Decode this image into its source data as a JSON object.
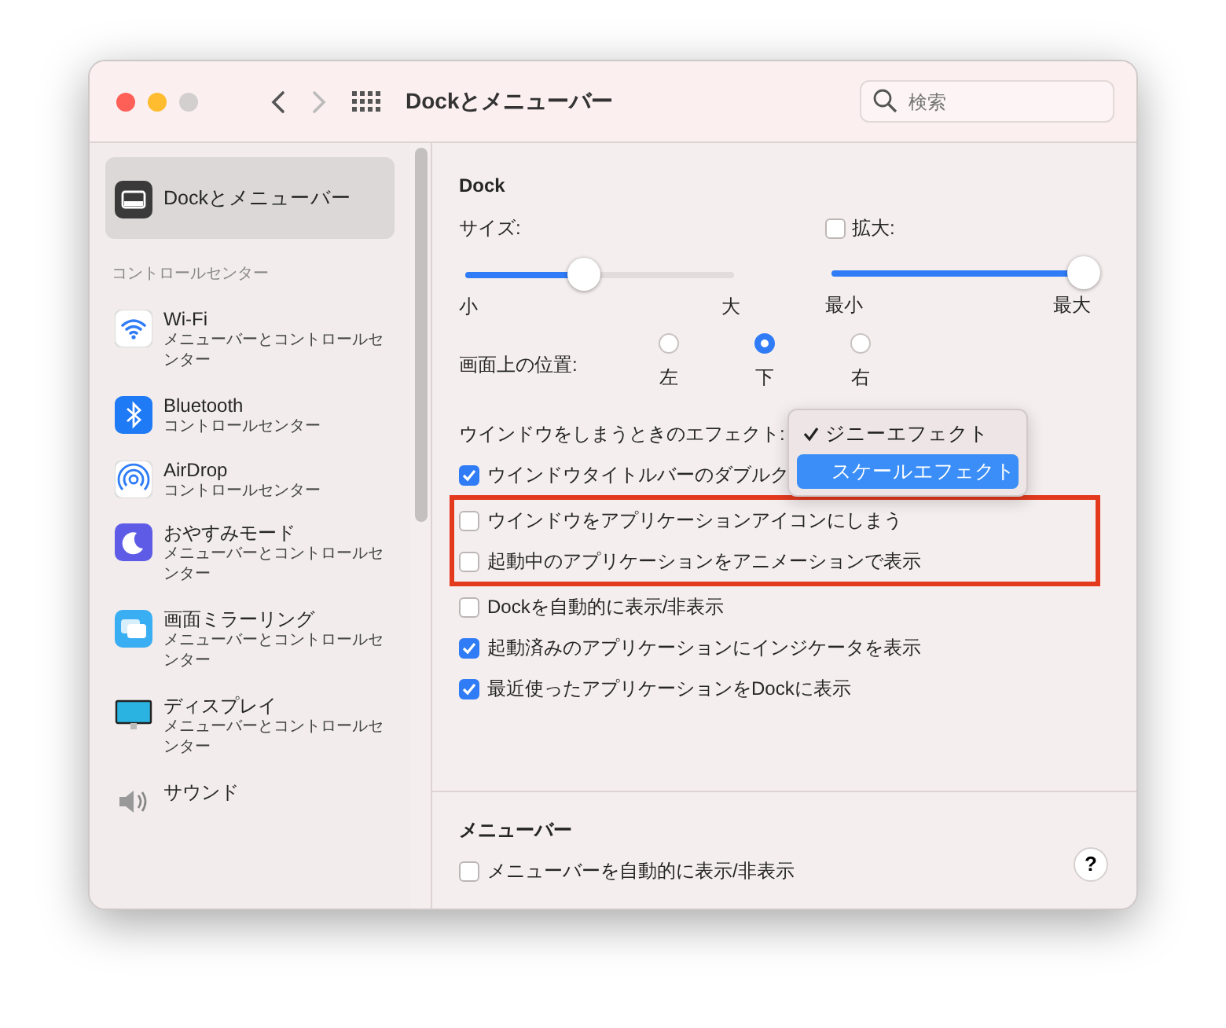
{
  "window": {
    "title": "Dockとメニューバー",
    "back_enabled": true,
    "forward_enabled": false
  },
  "search": {
    "placeholder": "検索"
  },
  "sidebar": {
    "selected_item": {
      "label": "Dockとメニューバー",
      "kind": "dock",
      "selected": true
    },
    "section_header": "コントロールセンター",
    "items": [
      {
        "label": "Wi-Fi",
        "subtitle": "メニューバーとコントロールセンター",
        "kind": "wifi",
        "selected": false
      },
      {
        "label": "Bluetooth",
        "subtitle": "コントロールセンター",
        "kind": "bluetooth",
        "selected": false
      },
      {
        "label": "AirDrop",
        "subtitle": "コントロールセンター",
        "kind": "airdrop",
        "selected": false
      },
      {
        "label": "おやすみモード",
        "subtitle": "メニューバーとコントロールセンター",
        "kind": "moon",
        "selected": false
      },
      {
        "label": "画面ミラーリング",
        "subtitle": "メニューバーとコントロールセンター",
        "kind": "mirroring",
        "selected": false
      },
      {
        "label": "ディスプレイ",
        "subtitle": "メニューバーとコントロールセンター",
        "kind": "display",
        "selected": false
      },
      {
        "label": "サウンド",
        "kind": "speaker",
        "selected": false
      }
    ]
  },
  "dock": {
    "title": "Dock",
    "size": {
      "label": "サイズ:",
      "level": 0.44,
      "min_label": "小",
      "max_label": "大"
    },
    "magnification": {
      "label": "拡大:",
      "checked": false,
      "level": 1.0,
      "min_label": "最小",
      "max_label": "最大"
    },
    "position": {
      "label": "画面上の位置:",
      "options": [
        {
          "label": "左",
          "selected": false
        },
        {
          "label": "下",
          "selected": true
        },
        {
          "label": "右",
          "selected": false
        }
      ]
    },
    "minimize_effect": {
      "label": "ウインドウをしまうときのエフェクト:",
      "menu": [
        {
          "label": "ジニーエフェクト",
          "checked": true,
          "highlighted": false
        },
        {
          "label": "スケールエフェクト",
          "checked": false,
          "highlighted": true
        }
      ]
    },
    "checkboxes": [
      {
        "label": "ウインドウタイトルバーのダブルク",
        "checked": true,
        "highlighted": false
      },
      {
        "label": "ウインドウをアプリケーションアイコンにしまう",
        "checked": false,
        "highlighted": true
      },
      {
        "label": "起動中のアプリケーションをアニメーションで表示",
        "checked": false,
        "highlighted": true
      },
      {
        "label": "Dockを自動的に表示/非表示",
        "checked": false,
        "highlighted": false
      },
      {
        "label": "起動済みのアプリケーションにインジケータを表示",
        "checked": true,
        "highlighted": false
      },
      {
        "label": "最近使ったアプリケーションをDockに表示",
        "checked": true,
        "highlighted": false
      }
    ]
  },
  "menu_bar": {
    "title": "メニューバー",
    "checkboxes": [
      {
        "label": "メニューバーを自動的に表示/非表示",
        "checked": false
      }
    ],
    "help_button": "?"
  }
}
